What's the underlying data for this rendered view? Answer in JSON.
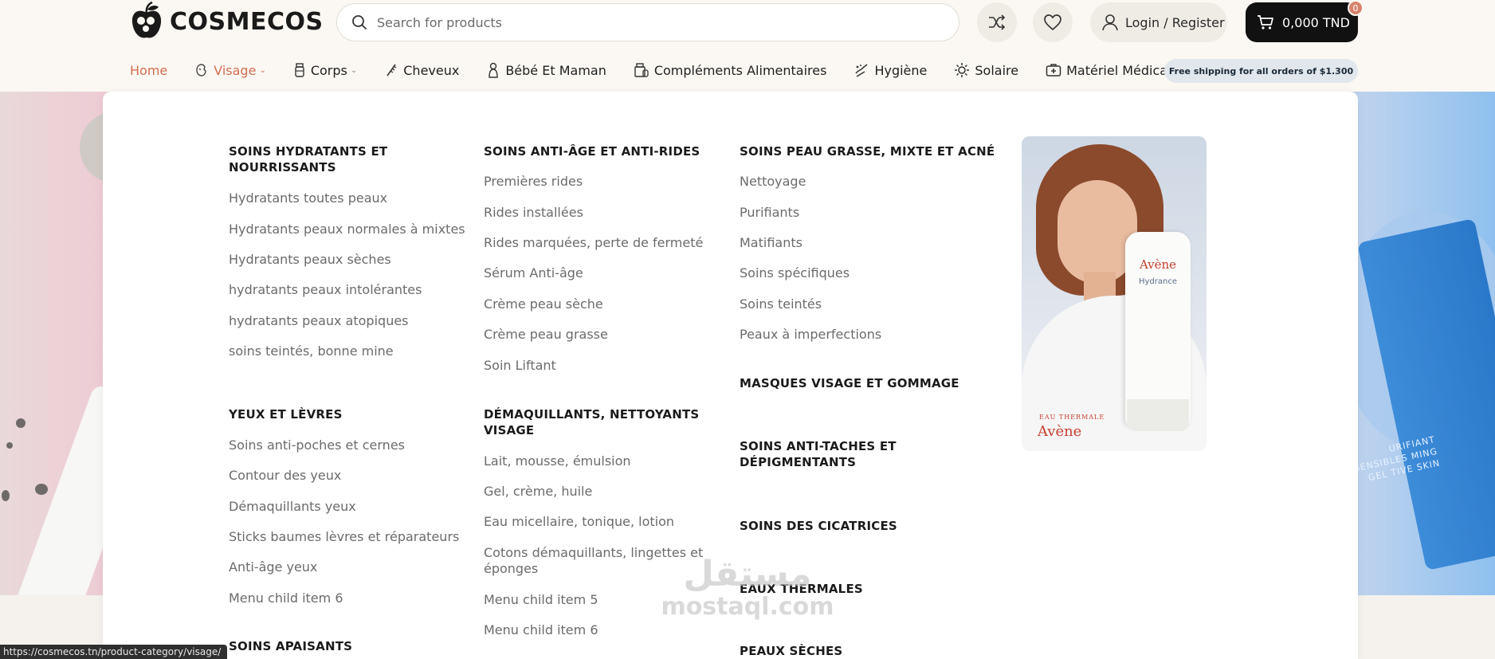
{
  "brand": {
    "name": "COSMECOS"
  },
  "search": {
    "placeholder": "Search for products"
  },
  "header": {
    "login_label": "Login / Register",
    "cart_total": "0,000 TND",
    "cart_count": "0"
  },
  "nav": [
    {
      "label": "Home",
      "icon": "none"
    },
    {
      "label": "Visage",
      "icon": "face-icon",
      "dropdown": true
    },
    {
      "label": "Corps",
      "icon": "bottle-icon",
      "dropdown": true
    },
    {
      "label": "Cheveux",
      "icon": "comb-icon"
    },
    {
      "label": "Bébé Et Maman",
      "icon": "baby-icon"
    },
    {
      "label": "Compléments Alimentaires",
      "icon": "supplement-icon"
    },
    {
      "label": "Hygiène",
      "icon": "hygiene-icon"
    },
    {
      "label": "Solaire",
      "icon": "sun-icon"
    },
    {
      "label": "Matériel Médical",
      "icon": "medical-kit-icon"
    }
  ],
  "shipping_banner": "Free shipping for all orders of $1.300",
  "mega_menu": {
    "col1": {
      "h1": "SOINS HYDRATANTS ET NOURRISSANTS",
      "l1": [
        "Hydratants toutes peaux",
        "Hydratants peaux normales à mixtes",
        "Hydratants peaux sèches",
        "hydratants peaux intolérantes",
        "hydratants peaux atopiques",
        "soins teintés, bonne mine"
      ],
      "h2": "YEUX ET LÈVRES",
      "l2": [
        "Soins anti-poches et cernes",
        "Contour des yeux",
        "Démaquillants yeux",
        "Sticks baumes lèvres et réparateurs",
        "Anti-âge yeux",
        "Menu child item 6"
      ],
      "h3": "SOINS APAISANTS"
    },
    "col2": {
      "h1": "SOINS ANTI-ÂGE ET ANTI-RIDES",
      "l1": [
        "Premières rides",
        "Rides installées",
        "Rides marquées, perte de fermeté",
        "Sérum Anti-âge",
        "Crème peau sèche",
        "Crème peau grasse",
        "Soin Liftant"
      ],
      "h2": "DÉMAQUILLANTS, NETTOYANTS VISAGE",
      "l2": [
        "Lait, mousse, émulsion",
        "Gel, crème, huile",
        "Eau micellaire, tonique, lotion",
        "Cotons démaquillants, lingettes et éponges",
        "Menu child item 5",
        "Menu child item 6"
      ]
    },
    "col3": {
      "h1": "SOINS PEAU GRASSE, MIXTE ET ACNÉ",
      "l1": [
        "Nettoyage",
        "Purifiants",
        "Matifiants",
        "Soins spécifiques",
        "Soins teintés",
        "Peaux à imperfections"
      ],
      "h2": "MASQUES VISAGE ET GOMMAGE",
      "h3": "SOINS ANTI-TACHES ET DÉPIGMENTANTS",
      "h4": "SOINS DES CICATRICES",
      "h5": "EAUX THERMALES",
      "h6": "PEAUX SÈCHES"
    },
    "promo": {
      "top": "EAU THERMALE",
      "brand": "Avène",
      "product_brand": "Avène",
      "product_name": "Hydrance"
    }
  },
  "hero_product_text": "URIFIANT SENSIBLES MING GEL TIVE SKIN",
  "watermark": {
    "arabic": "مستقل",
    "latin": "mostaql.com"
  },
  "status_url": "https://cosmecos.tn/product-category/visage/",
  "colors": {
    "accent": "#d36e50",
    "cart_bg": "#111111",
    "shipping_bg": "#e1e7ec"
  }
}
